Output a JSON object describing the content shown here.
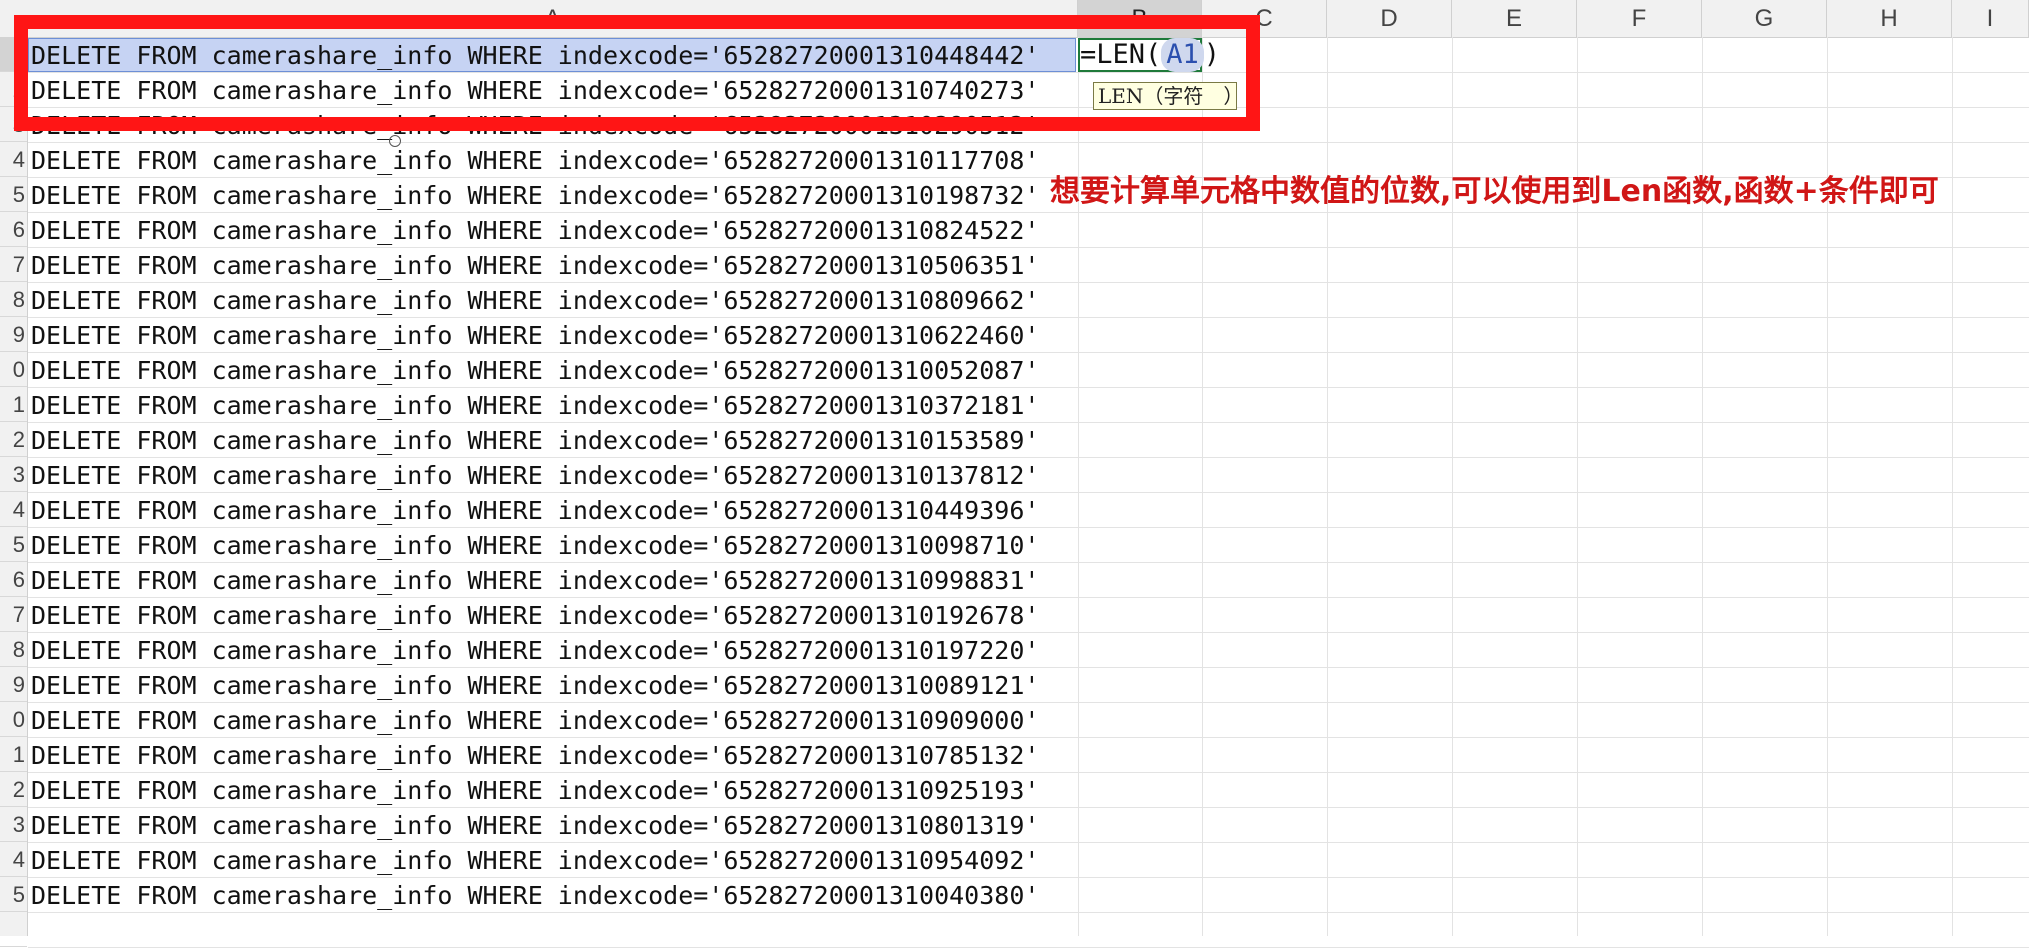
{
  "columns": [
    "A",
    "B",
    "C",
    "D",
    "E",
    "F",
    "G",
    "H",
    "I"
  ],
  "active_column": "B",
  "rows": [
    "1",
    "2",
    "3",
    "4",
    "5",
    "6",
    "7",
    "8",
    "9",
    "0",
    "1",
    "2",
    "3",
    "4",
    "5",
    "6",
    "7",
    "8",
    "9",
    "0",
    "1",
    "2",
    "3",
    "4",
    "5",
    ""
  ],
  "cells_a": [
    "DELETE FROM camerashare_info WHERE indexcode='65282720001310448442'",
    "DELETE FROM camerashare_info WHERE indexcode='65282720001310740273'",
    "DELETE FROM camerashare_info WHERE indexcode='65282720001310290512'",
    "DELETE FROM camerashare_info WHERE indexcode='65282720001310117708'",
    "DELETE FROM camerashare_info WHERE indexcode='65282720001310198732'",
    "DELETE FROM camerashare_info WHERE indexcode='65282720001310824522'",
    "DELETE FROM camerashare_info WHERE indexcode='65282720001310506351'",
    "DELETE FROM camerashare_info WHERE indexcode='65282720001310809662'",
    "DELETE FROM camerashare_info WHERE indexcode='65282720001310622460'",
    "DELETE FROM camerashare_info WHERE indexcode='65282720001310052087'",
    "DELETE FROM camerashare_info WHERE indexcode='65282720001310372181'",
    "DELETE FROM camerashare_info WHERE indexcode='65282720001310153589'",
    "DELETE FROM camerashare_info WHERE indexcode='65282720001310137812'",
    "DELETE FROM camerashare_info WHERE indexcode='65282720001310449396'",
    "DELETE FROM camerashare_info WHERE indexcode='65282720001310098710'",
    "DELETE FROM camerashare_info WHERE indexcode='65282720001310998831'",
    "DELETE FROM camerashare_info WHERE indexcode='65282720001310192678'",
    "DELETE FROM camerashare_info WHERE indexcode='65282720001310197220'",
    "DELETE FROM camerashare_info WHERE indexcode='65282720001310089121'",
    "DELETE FROM camerashare_info WHERE indexcode='65282720001310909000'",
    "DELETE FROM camerashare_info WHERE indexcode='65282720001310785132'",
    "DELETE FROM camerashare_info WHERE indexcode='65282720001310925193'",
    "DELETE FROM camerashare_info WHERE indexcode='65282720001310801319'",
    "DELETE FROM camerashare_info WHERE indexcode='65282720001310954092'",
    "DELETE FROM camerashare_info WHERE indexcode='65282720001310040380'"
  ],
  "formula": {
    "prefix": "=LEN(",
    "ref": "A1",
    "suffix": ")"
  },
  "tooltip": "LEN（字符　）",
  "annotation": "想要计算单元格中数值的位数,可以使用到Len函数,函数+条件即可",
  "colors": {
    "annotation": "#d01616",
    "frame": "#ff1515",
    "selection": "#c6d3f3"
  }
}
